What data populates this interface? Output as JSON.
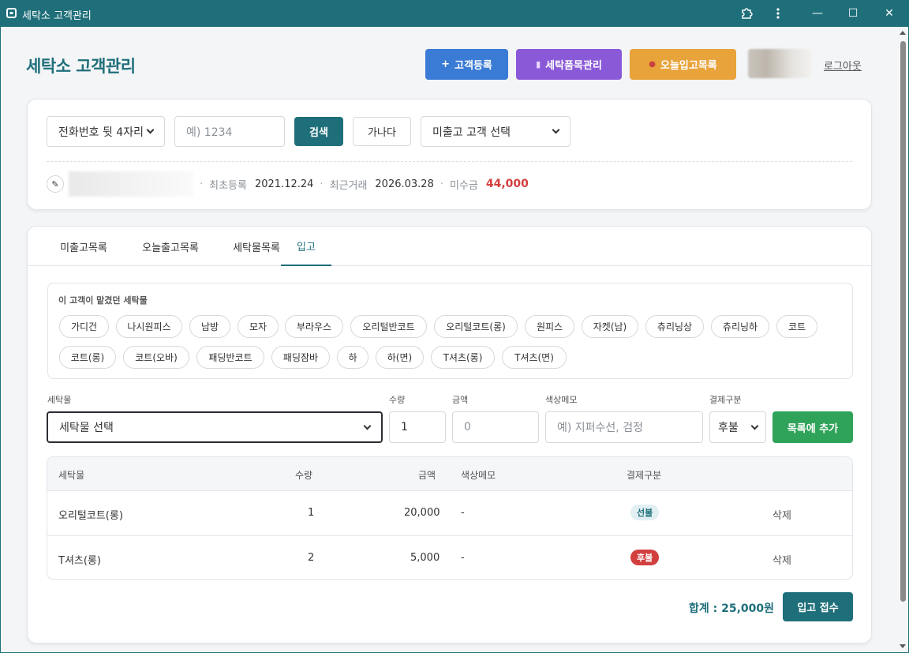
{
  "window": {
    "title": "세탁소 고객관리",
    "controls": {
      "extensions_icon": "puzzle-icon",
      "menu_icon": "kebab-icon",
      "minimize": "—",
      "maximize": "☐",
      "close": "✕"
    }
  },
  "header": {
    "title": "세탁소 고객관리",
    "buttons": {
      "register": {
        "icon": "+",
        "label": "고객등록"
      },
      "items": {
        "icon": "▮",
        "label": "세탁품목관리"
      },
      "today_in": {
        "icon": "●",
        "label": "오늘입고목록"
      }
    },
    "logout": "로그아웃"
  },
  "search": {
    "type_select": "전화번호 뒷 4자리",
    "input_placeholder": "예) 1234",
    "search_button": "검색",
    "ganada_button": "가나다",
    "customer_select": "미출고 고객 선택"
  },
  "customer": {
    "edit_icon": "✎",
    "first_label": "최초등록",
    "first_date": "2021.12.24",
    "recent_label": "최근거래",
    "recent_date": "2026.03.28",
    "unpaid_label": "미수금",
    "unpaid_amount": "44,000"
  },
  "tabs": {
    "unreleased": "미출고목록",
    "today_out": "오늘출고목록",
    "laundry_list": "세탁물목록",
    "intake": "입고"
  },
  "history": {
    "title": "이 고객이 맡겼던 세탁물",
    "chips": [
      "가디건",
      "나시원피스",
      "남방",
      "모자",
      "부라우스",
      "오리털반코트",
      "오리털코트(롱)",
      "원피스",
      "자켓(남)",
      "츄리닝상",
      "츄리닝하",
      "코트",
      "코트(롱)",
      "코트(오바)",
      "패딩반코트",
      "패딩잠바",
      "하",
      "하(면)",
      "T셔츠(롱)",
      "T셔츠(면)"
    ]
  },
  "form": {
    "labels": {
      "item": "세탁물",
      "qty": "수량",
      "amount": "금액",
      "memo": "색상메모",
      "pay": "결제구분"
    },
    "item_select": "세탁물 선택",
    "qty_value": "1",
    "amount_placeholder": "0",
    "memo_placeholder": "예) 지퍼수선, 검정",
    "pay_select": "후불",
    "add_button": "목록에 추가"
  },
  "table": {
    "headers": {
      "item": "세탁물",
      "qty": "수량",
      "amount": "금액",
      "memo": "색상메모",
      "pay": "결제구분"
    },
    "rows": [
      {
        "item": "오리털코트(롱)",
        "qty": "1",
        "amount": "20,000",
        "memo": "-",
        "pay": "선불",
        "delete": "삭제"
      },
      {
        "item": "T셔츠(롱)",
        "qty": "2",
        "amount": "5,000",
        "memo": "-",
        "pay": "후불",
        "delete": "삭제"
      }
    ]
  },
  "footer": {
    "total": "합계 : 25,000원",
    "submit": "입고 접수"
  },
  "colors": {
    "primary": "#1f6f7a",
    "blue": "#3a7bd5",
    "purple": "#8a59d8",
    "orange": "#e8a33a",
    "green": "#2fa35a",
    "danger": "#d23f3f"
  }
}
